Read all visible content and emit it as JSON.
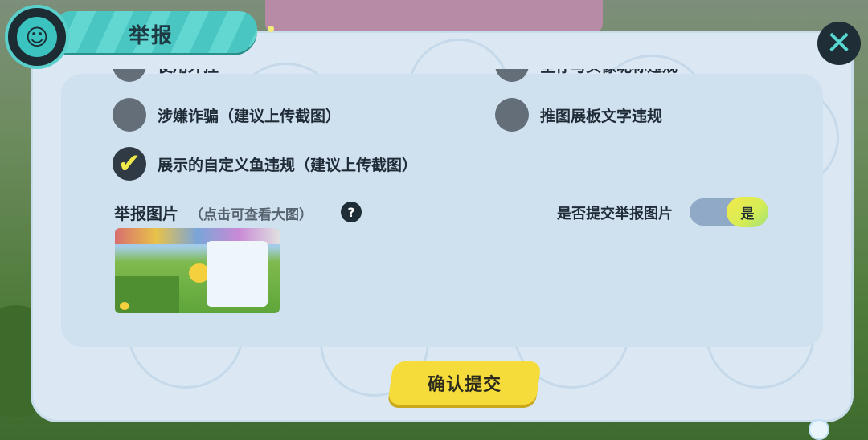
{
  "header": {
    "title": "举报"
  },
  "options": [
    {
      "label": "使用外挂",
      "checked": false
    },
    {
      "label": "全存与头像昵称违规",
      "checked": false
    },
    {
      "label": "涉嫌诈骗（建议上传截图）",
      "checked": false
    },
    {
      "label": "推图展板文字违规",
      "checked": false
    },
    {
      "label": "展示的自定义鱼违规（建议上传截图）",
      "checked": true
    }
  ],
  "image_section": {
    "title": "举报图片",
    "hint": "（点击可查看大图）",
    "help_icon": "?"
  },
  "submit_toggle": {
    "label": "是否提交举报图片",
    "value": "是"
  },
  "confirm_button": {
    "label": "确认提交"
  },
  "close_icon": "✕",
  "colors": {
    "accent": "#49c6c1",
    "confirm": "#f6dc3a",
    "panel": "#dbe8f3"
  }
}
